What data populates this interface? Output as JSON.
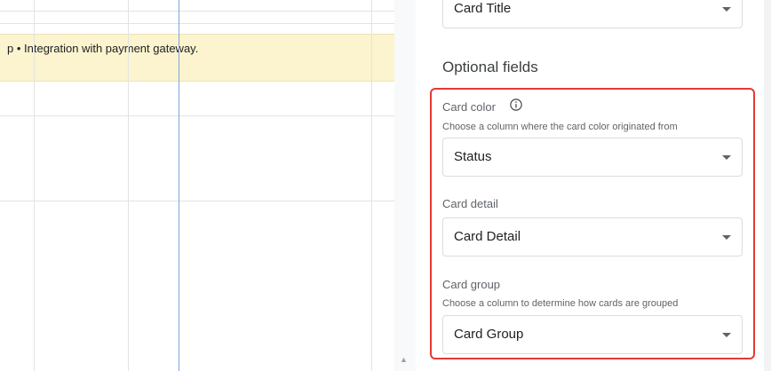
{
  "sheet": {
    "row_text": "p • Integration with payment gateway."
  },
  "panel": {
    "top_select_value": "Card Title",
    "optional_title": "Optional fields",
    "card_color": {
      "label": "Card color",
      "help": "Choose a column where the card color originated from",
      "value": "Status"
    },
    "card_detail": {
      "label": "Card detail",
      "value": "Card Detail"
    },
    "card_group": {
      "label": "Card group",
      "help": "Choose a column to determine how cards are grouped",
      "value": "Card Group"
    }
  },
  "icons": {
    "info": "info-icon",
    "dropdown": "chevron-down-icon",
    "scroll_up": "scroll-up-arrow-icon"
  },
  "colors": {
    "highlight_row": "#fbf4cf",
    "annotation_border": "#e53935",
    "selected_column_line": "#7da7d9"
  }
}
